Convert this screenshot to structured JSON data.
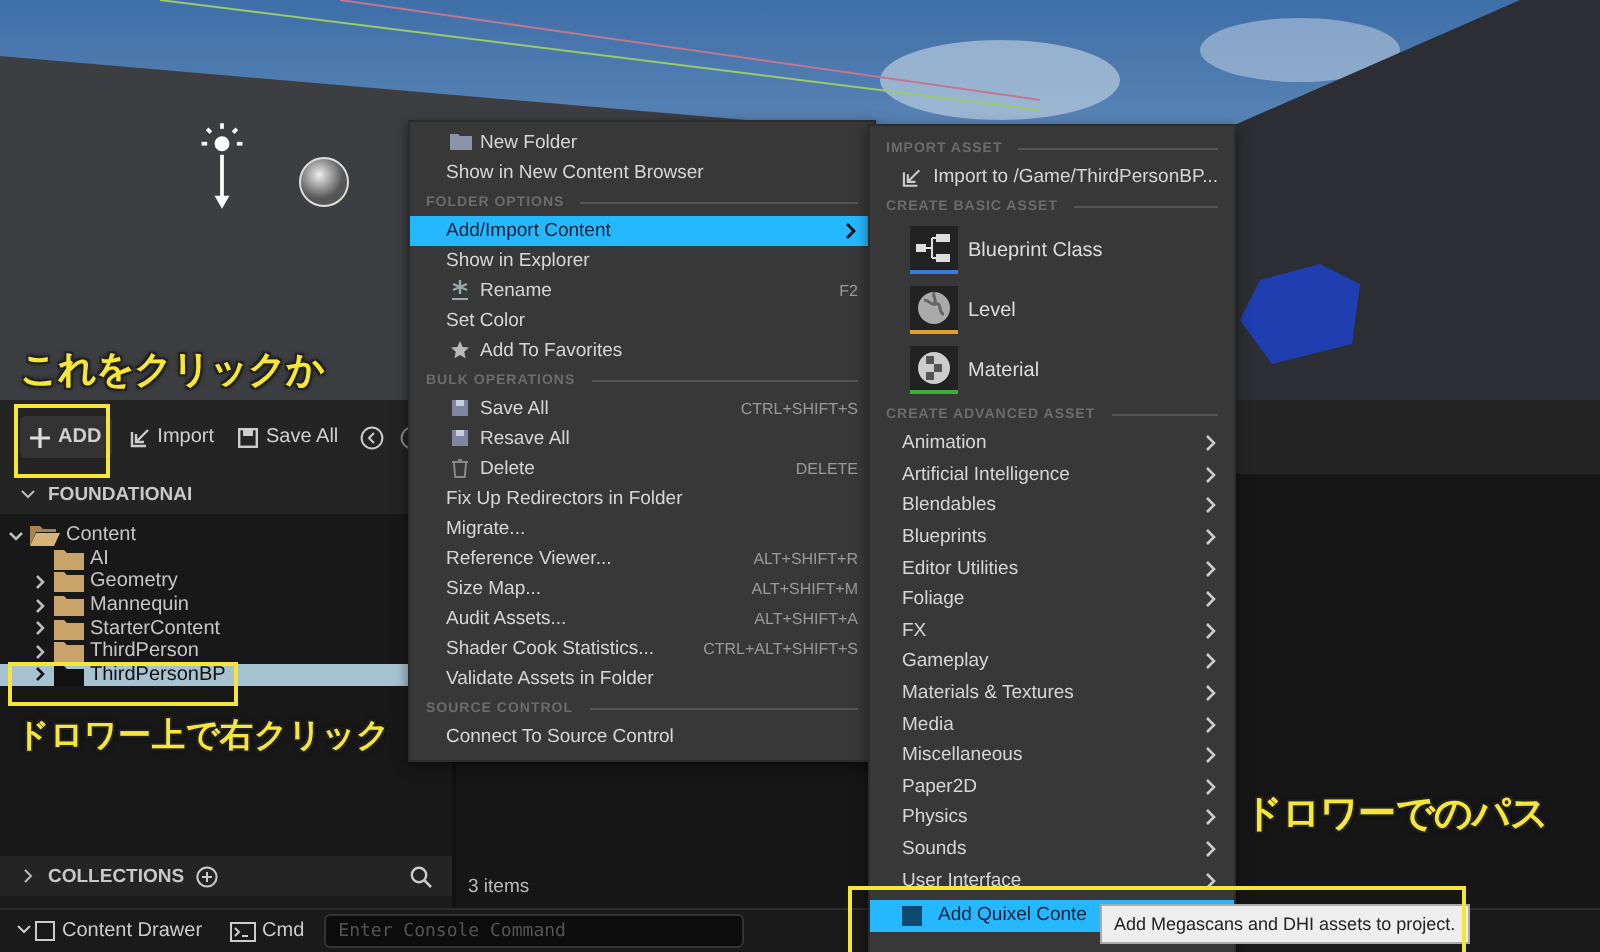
{
  "toolbar": {
    "buttons": [
      {
        "kind": "add",
        "label": "ADD"
      },
      {
        "kind": "import",
        "label": "Import"
      },
      {
        "kind": "save",
        "label": "Save All"
      }
    ]
  },
  "sources": {
    "title": "FOUNDATIONAI",
    "tree": [
      {
        "label": "Content",
        "expanded": true,
        "selected": false,
        "children": [
          {
            "label": "AI",
            "selected": false
          },
          {
            "label": "Geometry",
            "expanded": false,
            "selected": false
          },
          {
            "label": "Mannequin",
            "expanded": false,
            "selected": false
          },
          {
            "label": "StarterContent",
            "expanded": false,
            "selected": false
          },
          {
            "label": "ThirdPerson",
            "expanded": false,
            "selected": false
          },
          {
            "label": "ThirdPersonBP",
            "expanded": false,
            "selected": true
          }
        ]
      }
    ]
  },
  "collections": {
    "title": "COLLECTIONS"
  },
  "asset_view": {
    "count": "3 items"
  },
  "status_bar": {
    "drawer": "Content Drawer",
    "cmd": "Cmd",
    "console_placeholder": "Enter Console Command"
  },
  "context_menu": {
    "items": [
      {
        "kind": "new",
        "label": "New Folder",
        "highlighted": false,
        "submenu": false
      },
      {
        "kind": "item",
        "label": "Show in New Content Browser",
        "highlighted": false,
        "submenu": false
      },
      {
        "kind": "section",
        "label": "FOLDER OPTIONS"
      },
      {
        "kind": "item",
        "label": "Add/Import Content",
        "highlighted": true,
        "submenu": true
      },
      {
        "kind": "item",
        "label": "Show in Explorer",
        "highlighted": false,
        "submenu": false
      },
      {
        "kind": "rename",
        "label": "Rename",
        "shortcut": "F2",
        "highlighted": false,
        "submenu": false
      },
      {
        "kind": "item",
        "label": "Set Color",
        "highlighted": false,
        "submenu": false
      },
      {
        "kind": "favorite",
        "label": "Add To Favorites",
        "highlighted": false,
        "submenu": false
      },
      {
        "kind": "section",
        "label": "BULK OPERATIONS"
      },
      {
        "kind": "save",
        "label": "Save All",
        "shortcut": "CTRL+SHIFT+S",
        "highlighted": false,
        "submenu": false
      },
      {
        "kind": "save",
        "label": "Resave All",
        "highlighted": false,
        "submenu": false
      },
      {
        "kind": "delete",
        "label": "Delete",
        "shortcut": "DELETE",
        "highlighted": false,
        "submenu": false
      },
      {
        "kind": "item",
        "label": "Fix Up Redirectors in Folder",
        "highlighted": false,
        "submenu": false
      },
      {
        "kind": "item",
        "label": "Migrate...",
        "highlighted": false,
        "submenu": false
      },
      {
        "kind": "item",
        "label": "Reference Viewer...",
        "shortcut": "ALT+SHIFT+R",
        "highlighted": false,
        "submenu": false
      },
      {
        "kind": "item",
        "label": "Size Map...",
        "shortcut": "ALT+SHIFT+M",
        "highlighted": false,
        "submenu": false
      },
      {
        "kind": "item",
        "label": "Audit Assets...",
        "shortcut": "ALT+SHIFT+A",
        "highlighted": false,
        "submenu": false
      },
      {
        "kind": "item",
        "label": "Shader Cook Statistics...",
        "shortcut": "CTRL+ALT+SHIFT+S",
        "highlighted": false,
        "submenu": false
      },
      {
        "kind": "item",
        "label": "Validate Assets in Folder",
        "highlighted": false,
        "submenu": false
      },
      {
        "kind": "section",
        "label": "SOURCE CONTROL"
      },
      {
        "kind": "item",
        "label": "Connect To Source Control",
        "highlighted": false,
        "submenu": false
      }
    ]
  },
  "submenu": {
    "items": [
      {
        "kind": "section",
        "label": "IMPORT ASSET"
      },
      {
        "kind": "action",
        "label": "Import to /Game/ThirdPersonBP...",
        "highlighted": false
      },
      {
        "kind": "section",
        "label": "CREATE BASIC ASSET"
      },
      {
        "kind": "blueprint",
        "label": "Blueprint Class",
        "color": "#3d78e0",
        "highlighted": false
      },
      {
        "kind": "level",
        "label": "Level",
        "color": "#e0a030",
        "highlighted": false
      },
      {
        "kind": "material",
        "label": "Material",
        "color": "#3cae3c",
        "highlighted": false
      },
      {
        "kind": "section",
        "label": "CREATE ADVANCED ASSET"
      },
      {
        "kind": "category",
        "label": "Animation",
        "highlighted": false
      },
      {
        "kind": "category",
        "label": "Artificial Intelligence",
        "highlighted": false
      },
      {
        "kind": "category",
        "label": "Blendables",
        "highlighted": false
      },
      {
        "kind": "category",
        "label": "Blueprints",
        "highlighted": false
      },
      {
        "kind": "category",
        "label": "Editor Utilities",
        "highlighted": false
      },
      {
        "kind": "category",
        "label": "Foliage",
        "highlighted": false
      },
      {
        "kind": "category",
        "label": "FX",
        "highlighted": false
      },
      {
        "kind": "category",
        "label": "Gameplay",
        "highlighted": false
      },
      {
        "kind": "category",
        "label": "Materials & Textures",
        "highlighted": false
      },
      {
        "kind": "category",
        "label": "Media",
        "highlighted": false
      },
      {
        "kind": "category",
        "label": "Miscellaneous",
        "highlighted": false
      },
      {
        "kind": "category",
        "label": "Paper2D",
        "highlighted": false
      },
      {
        "kind": "category",
        "label": "Physics",
        "highlighted": false
      },
      {
        "kind": "category",
        "label": "Sounds",
        "highlighted": false
      },
      {
        "kind": "category",
        "label": "User Interface",
        "highlighted": false
      },
      {
        "kind": "quixel",
        "label": "Add Quixel Conte",
        "highlighted": true
      }
    ]
  },
  "tooltip": {
    "text": "Add Megascans and DHI assets to project."
  },
  "annotations": [
    {
      "text": "これをクリックか"
    },
    {
      "text": "ドロワー上で右クリック"
    },
    {
      "text": "ドロワーでのパス"
    }
  ]
}
